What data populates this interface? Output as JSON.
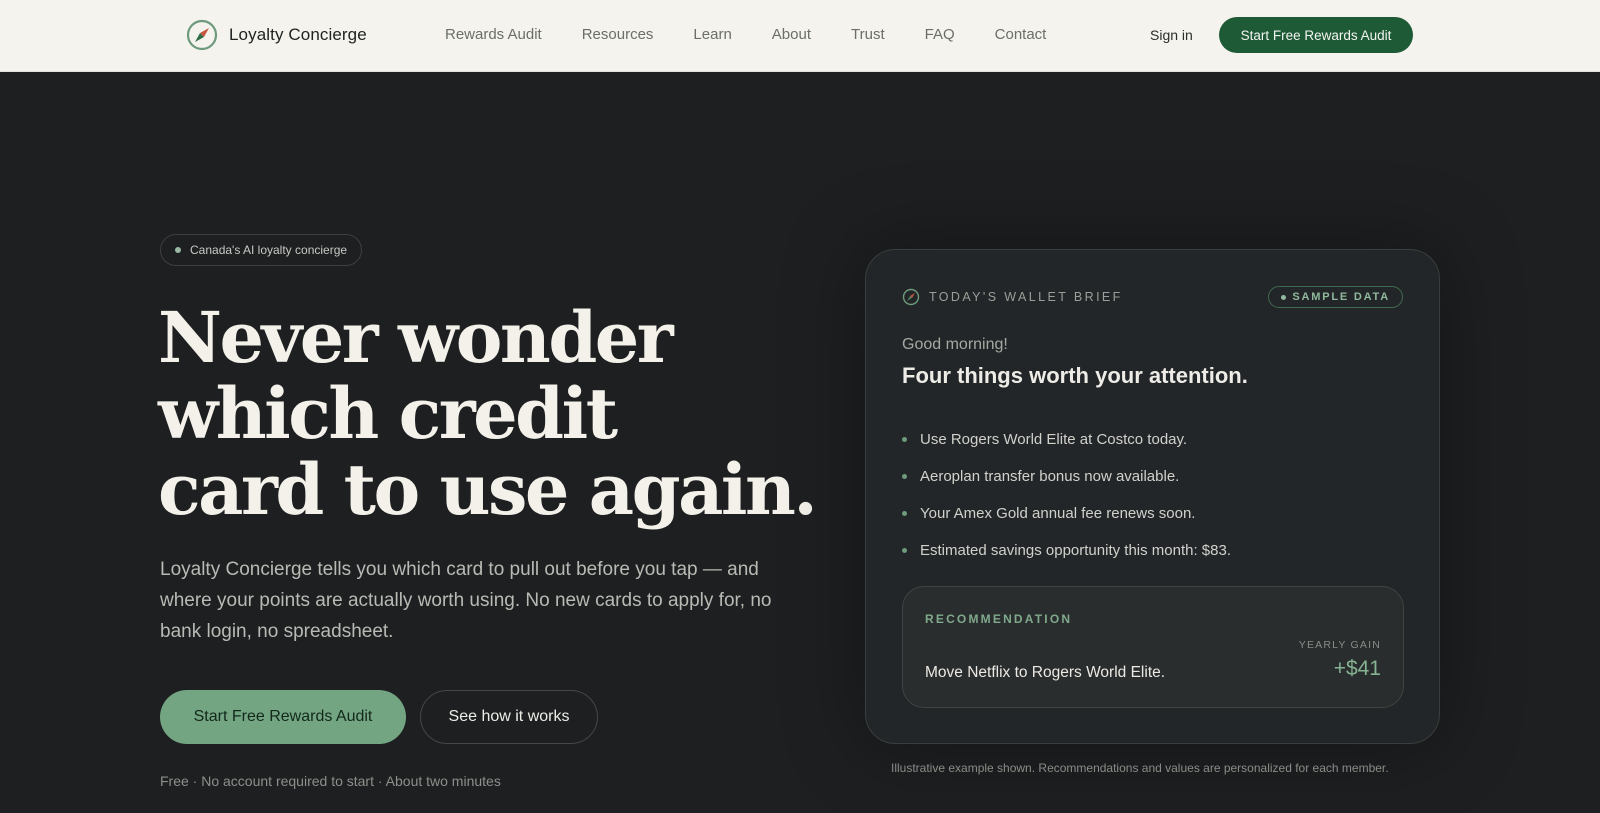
{
  "header": {
    "brand": "Loyalty Concierge",
    "nav": [
      "Rewards Audit",
      "Resources",
      "Learn",
      "About",
      "Trust",
      "FAQ",
      "Contact"
    ],
    "sign_in": "Sign in",
    "cta": "Start Free Rewards Audit"
  },
  "hero": {
    "pill": "Canada's AI loyalty concierge",
    "headline_lines": [
      "Never wonder",
      "which credit",
      "card to use again."
    ],
    "lede": "Loyalty Concierge tells you which card to pull out before you tap — and where your points are actually worth using. No new cards to apply for, no bank login, no spreadsheet.",
    "primary_button": "Start Free Rewards Audit",
    "secondary_button": "See how it works",
    "fineprint": "Free · No account required to start · About two minutes"
  },
  "card": {
    "label": "TODAY'S WALLET BRIEF",
    "badge": "SAMPLE DATA",
    "greeting": "Good morning!",
    "title": "Four things worth your attention.",
    "items": [
      "Use Rogers World Elite at Costco today.",
      "Aeroplan transfer bonus now available.",
      "Your Amex Gold annual fee renews soon.",
      "Estimated savings opportunity this month: $83."
    ],
    "recommendation": {
      "label": "RECOMMENDATION",
      "text": "Move Netflix to Rogers World Elite.",
      "gain_label": "YEARLY GAIN",
      "gain_value": "+$41"
    },
    "note": "Illustrative example shown. Recommendations and values are personalized for each member."
  },
  "colors": {
    "page_bg": "#1d1f21",
    "header_bg": "#f4f3ee",
    "brand_green": "#1f5a37",
    "accent_green": "#74a583"
  },
  "icons": [
    "compass-icon",
    "dot-icon"
  ]
}
